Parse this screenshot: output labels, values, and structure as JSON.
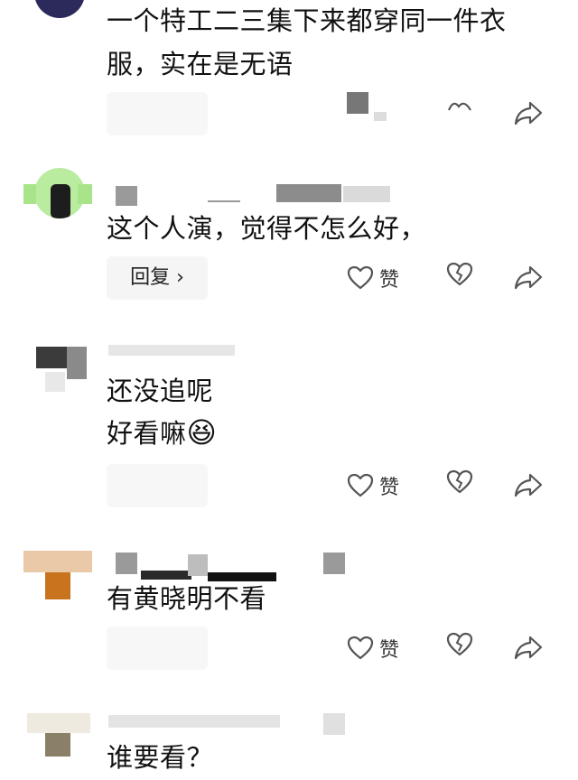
{
  "comments": [
    {
      "text_lines": [
        "一个特工二三集下来都穿同一件衣",
        "服，实在是无语"
      ],
      "reply_label": "",
      "like_label": ""
    },
    {
      "text_lines": [
        "这个人演，觉得不怎么好，"
      ],
      "reply_label": "回复 ›",
      "like_label": "赞"
    },
    {
      "text_lines": [
        "还没追呢",
        "好看嘛"
      ],
      "emoji": "😆",
      "reply_label": "",
      "like_label": "赞"
    },
    {
      "text_lines": [
        "有黄晓明不看"
      ],
      "reply_label": "",
      "like_label": "赞"
    },
    {
      "text_lines": [
        "谁要看？"
      ],
      "reply_label": "",
      "like_label": ""
    }
  ],
  "icons": {
    "like": "heart-outline-icon",
    "dislike": "broken-heart-icon",
    "share": "share-arrow-icon"
  },
  "colors": {
    "icon": "#555555",
    "reply_bg": "#f5f5f5"
  }
}
